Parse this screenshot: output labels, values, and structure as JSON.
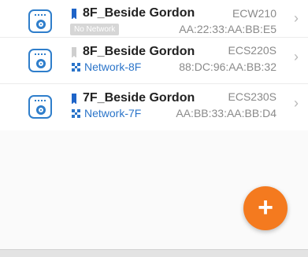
{
  "devices": [
    {
      "name": "8F_Beside Gordon",
      "model": "ECW210",
      "mac": "AA:22:33:AA:BB:E5",
      "network": "No Network",
      "online": true,
      "icon": "camera-device-icon"
    },
    {
      "name": "8F_Beside Gordon",
      "model": "ECS220S",
      "mac": "88:DC:96:AA:BB:32",
      "network": "Network-8F",
      "online": false,
      "icon": "camera-device-icon"
    },
    {
      "name": "7F_Beside Gordon",
      "model": "ECS230S",
      "mac": "AA:BB:33:AA:BB:D4",
      "network": "Network-7F",
      "online": true,
      "icon": "camera-device-icon"
    }
  ],
  "fab": {
    "label": "+"
  },
  "colors": {
    "accent": "#f47a1f",
    "online_flag": "#1e64c8",
    "offline_flag": "#cfcfcf",
    "network_text": "#2a74c9"
  }
}
